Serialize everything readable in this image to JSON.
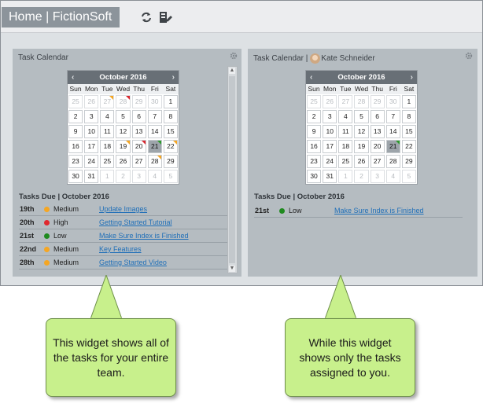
{
  "header": {
    "brand": "Home | FictionSoft",
    "icons": [
      "refresh-icon",
      "edit-layout-icon"
    ]
  },
  "left_widget": {
    "title": "Task Calendar",
    "calendar": {
      "month": "October 2016",
      "weekdays": [
        "Sun",
        "Mon",
        "Tue",
        "Wed",
        "Thu",
        "Fri",
        "Sat"
      ],
      "weeks": [
        [
          {
            "d": "25",
            "o": 1
          },
          {
            "d": "26",
            "o": 1
          },
          {
            "d": "27",
            "o": 1,
            "f": "orange"
          },
          {
            "d": "28",
            "o": 1,
            "f": "red"
          },
          {
            "d": "29",
            "o": 1
          },
          {
            "d": "30",
            "o": 1
          },
          {
            "d": "1"
          }
        ],
        [
          {
            "d": "2"
          },
          {
            "d": "3"
          },
          {
            "d": "4"
          },
          {
            "d": "5"
          },
          {
            "d": "6"
          },
          {
            "d": "7"
          },
          {
            "d": "8"
          }
        ],
        [
          {
            "d": "9"
          },
          {
            "d": "10"
          },
          {
            "d": "11"
          },
          {
            "d": "12"
          },
          {
            "d": "13"
          },
          {
            "d": "14"
          },
          {
            "d": "15"
          }
        ],
        [
          {
            "d": "16"
          },
          {
            "d": "17"
          },
          {
            "d": "18"
          },
          {
            "d": "19",
            "f": "orange"
          },
          {
            "d": "20",
            "f": "red"
          },
          {
            "d": "21",
            "t": 1,
            "f": "green"
          },
          {
            "d": "22",
            "f": "orange"
          }
        ],
        [
          {
            "d": "23"
          },
          {
            "d": "24"
          },
          {
            "d": "25"
          },
          {
            "d": "26"
          },
          {
            "d": "27"
          },
          {
            "d": "28",
            "f": "orange"
          },
          {
            "d": "29"
          }
        ],
        [
          {
            "d": "30"
          },
          {
            "d": "31"
          },
          {
            "d": "1",
            "o": 1
          },
          {
            "d": "2",
            "o": 1
          },
          {
            "d": "3",
            "o": 1
          },
          {
            "d": "4",
            "o": 1
          },
          {
            "d": "5",
            "o": 1
          }
        ]
      ]
    },
    "tasks_heading": "Tasks Due | October 2016",
    "tasks": [
      {
        "date": "19th",
        "priority": "Medium",
        "color": "#f5a623",
        "link": "Update Images"
      },
      {
        "date": "20th",
        "priority": "High",
        "color": "#e0282e",
        "link": "Getting Started Tutorial"
      },
      {
        "date": "21st",
        "priority": "Low",
        "color": "#1f8a1f",
        "link": "Make Sure Index is Finished"
      },
      {
        "date": "22nd",
        "priority": "Medium",
        "color": "#f5a623",
        "link": "Key Features"
      },
      {
        "date": "28th",
        "priority": "Medium",
        "color": "#f5a623",
        "link": "Getting Started Video"
      }
    ]
  },
  "right_widget": {
    "title": "Task Calendar |",
    "user": "Kate Schneider",
    "calendar": {
      "month": "October 2016",
      "weekdays": [
        "Sun",
        "Mon",
        "Tue",
        "Wed",
        "Thu",
        "Fri",
        "Sat"
      ],
      "weeks": [
        [
          {
            "d": "25",
            "o": 1
          },
          {
            "d": "26",
            "o": 1
          },
          {
            "d": "27",
            "o": 1
          },
          {
            "d": "28",
            "o": 1
          },
          {
            "d": "29",
            "o": 1
          },
          {
            "d": "30",
            "o": 1
          },
          {
            "d": "1"
          }
        ],
        [
          {
            "d": "2"
          },
          {
            "d": "3"
          },
          {
            "d": "4"
          },
          {
            "d": "5"
          },
          {
            "d": "6"
          },
          {
            "d": "7"
          },
          {
            "d": "8"
          }
        ],
        [
          {
            "d": "9"
          },
          {
            "d": "10"
          },
          {
            "d": "11"
          },
          {
            "d": "12"
          },
          {
            "d": "13"
          },
          {
            "d": "14"
          },
          {
            "d": "15"
          }
        ],
        [
          {
            "d": "16"
          },
          {
            "d": "17"
          },
          {
            "d": "18"
          },
          {
            "d": "19"
          },
          {
            "d": "20"
          },
          {
            "d": "21",
            "t": 1,
            "f": "green"
          },
          {
            "d": "22"
          }
        ],
        [
          {
            "d": "23"
          },
          {
            "d": "24"
          },
          {
            "d": "25"
          },
          {
            "d": "26"
          },
          {
            "d": "27"
          },
          {
            "d": "28"
          },
          {
            "d": "29"
          }
        ],
        [
          {
            "d": "30"
          },
          {
            "d": "31"
          },
          {
            "d": "1",
            "o": 1
          },
          {
            "d": "2",
            "o": 1
          },
          {
            "d": "3",
            "o": 1
          },
          {
            "d": "4",
            "o": 1
          },
          {
            "d": "5",
            "o": 1
          }
        ]
      ]
    },
    "tasks_heading": "Tasks Due | October 2016",
    "tasks": [
      {
        "date": "21st",
        "priority": "Low",
        "color": "#1f8a1f",
        "link": "Make Sure Index is Finished"
      }
    ]
  },
  "callouts": [
    {
      "text": "This widget shows all of the tasks for your entire team."
    },
    {
      "text": "While this widget shows only the tasks assigned to you."
    }
  ],
  "colors": {
    "callout_fill": "#c8f08c",
    "brand_bar": "#8c949b",
    "link": "#1f6fb8"
  }
}
